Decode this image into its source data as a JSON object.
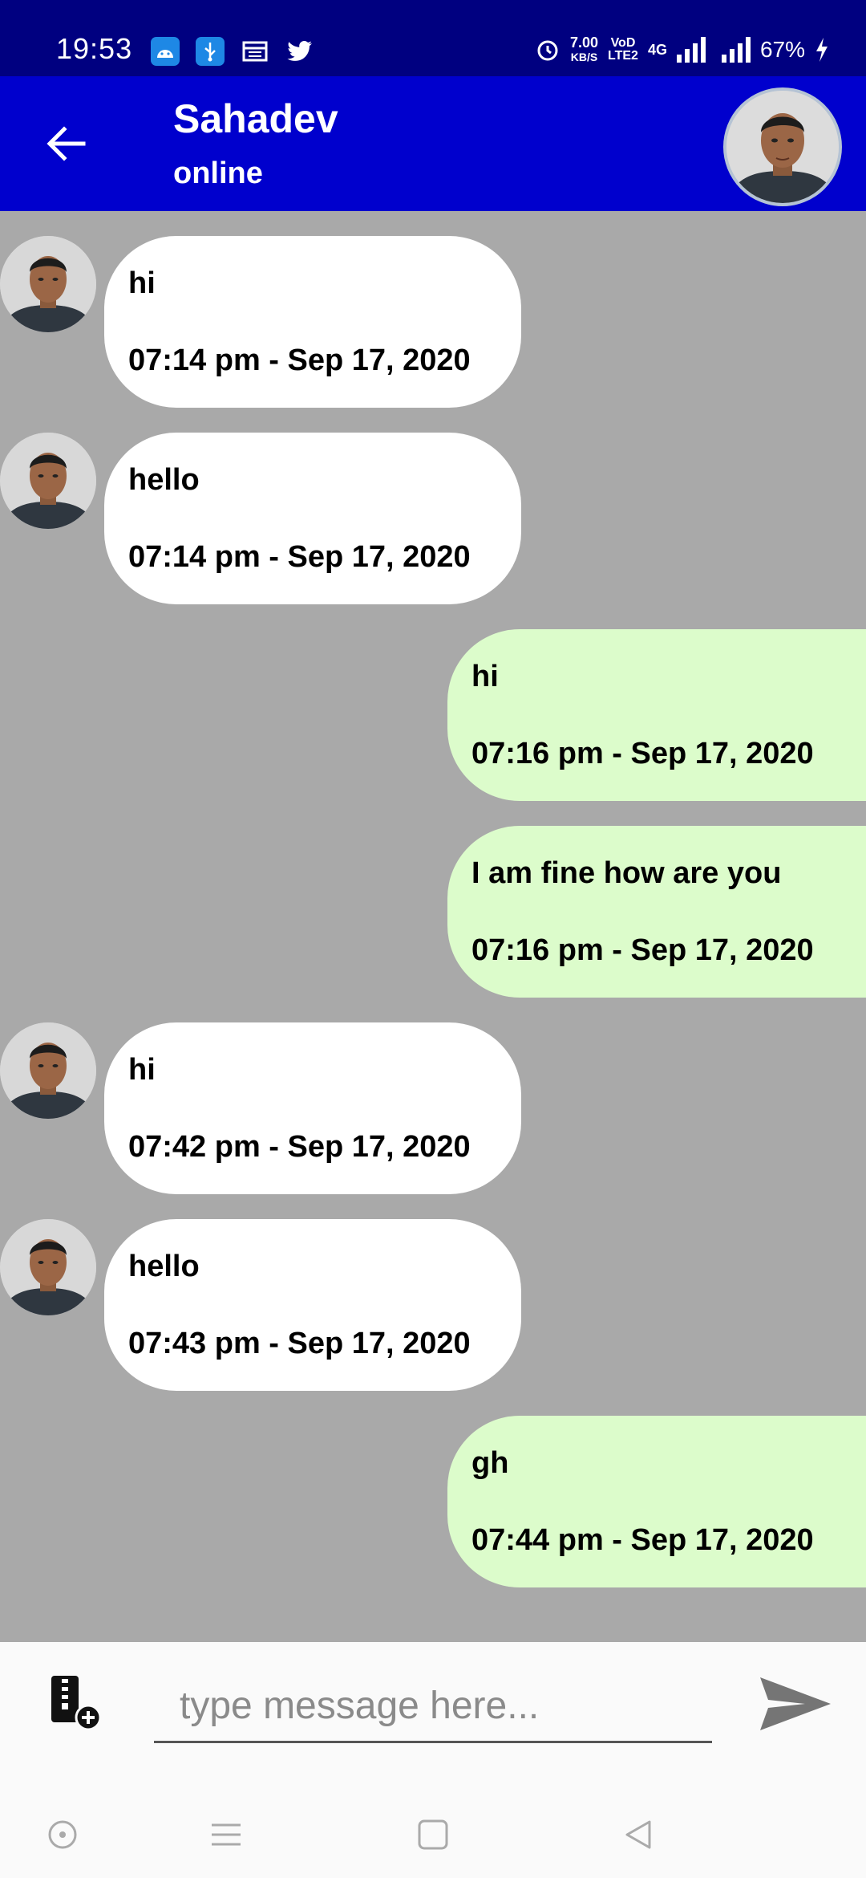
{
  "status_bar": {
    "time": "19:53",
    "net_speed_value": "7.00",
    "net_speed_unit": "KB/S",
    "vo_line1": "VoD",
    "vo_line2": "LTE2",
    "network": "4G",
    "battery": "67%"
  },
  "header": {
    "contact_name": "Sahadev",
    "presence": "online"
  },
  "messages": [
    {
      "direction": "incoming",
      "text": "hi",
      "time": "07:14 pm - Sep 17, 2020"
    },
    {
      "direction": "incoming",
      "text": "hello",
      "time": "07:14 pm - Sep 17, 2020"
    },
    {
      "direction": "outgoing",
      "text": "hi",
      "time": "07:16 pm - Sep 17, 2020"
    },
    {
      "direction": "outgoing",
      "text": "I am fine how are you",
      "time": "07:16 pm - Sep 17, 2020"
    },
    {
      "direction": "incoming",
      "text": "hi",
      "time": "07:42 pm - Sep 17, 2020"
    },
    {
      "direction": "incoming",
      "text": "hello",
      "time": "07:43 pm - Sep 17, 2020"
    },
    {
      "direction": "outgoing",
      "text": "gh",
      "time": "07:44 pm - Sep 17, 2020"
    }
  ],
  "composer": {
    "placeholder": "type message here..."
  },
  "colors": {
    "status_bar": "#000080",
    "header": "#0000cd",
    "chat_background": "#a9a9a9",
    "incoming_bubble": "#ffffff",
    "outgoing_bubble": "#dcfccb"
  }
}
